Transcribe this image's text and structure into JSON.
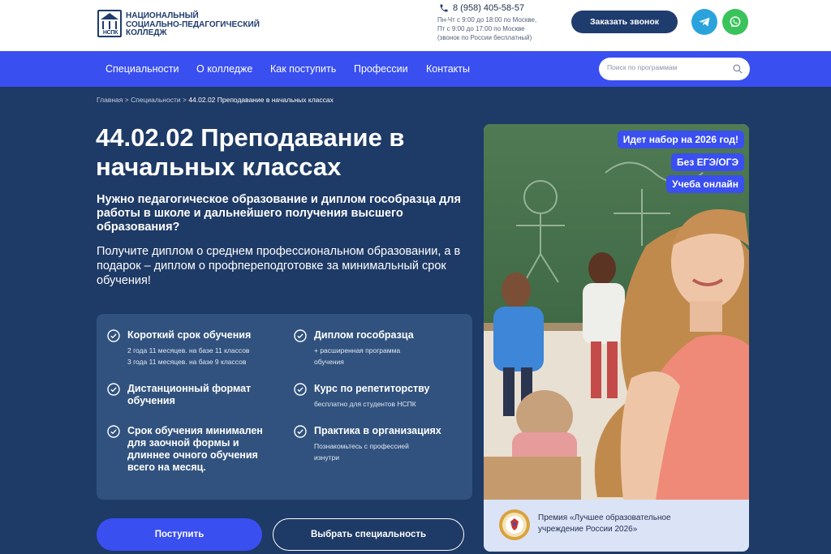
{
  "header": {
    "logo_abbr": "НСПК",
    "logo_text_1": "Национальный",
    "logo_text_2": "социально-педагогический",
    "logo_text_3": "колледж",
    "phone": "8 (958) 405-58-57",
    "hours_1": "Пн-Чт с 9:00 до 18:00 по Москве,",
    "hours_2": "Пт с 9:00 до 17:00 по Москве",
    "hours_3": "(звонок по России бесплатный)",
    "callback_label": "Заказать звонок",
    "icons": {
      "phone": "phone-icon",
      "telegram": "telegram-icon",
      "whatsapp": "whatsapp-icon"
    },
    "colors": {
      "telegram": "#2aa3dc",
      "whatsapp": "#39c35a",
      "brand": "#1f3c6e"
    }
  },
  "nav": {
    "items": [
      {
        "label": "Специальности"
      },
      {
        "label": "О колледже"
      },
      {
        "label": "Как поступить"
      },
      {
        "label": "Профессии"
      },
      {
        "label": "Контакты"
      }
    ],
    "search_placeholder": "Поиск по программам",
    "color": "#3a4ff0"
  },
  "breadcrumb": {
    "home": "Главная",
    "section": "Специальности",
    "separator": ">",
    "current": "44.02.02 Преподавание в начальных классах"
  },
  "main": {
    "title_line1": "44.02.02 Преподавание в",
    "title_line2": "начальных классах",
    "subtitle": "Нужно педагогическое образование и диплом гособразца для работы в школе и дальнейшего получения высшего образования?",
    "lead": "Получите диплом о среднем профессиональном образовании, а в подарок – диплом о профпереподготовке за минимальный срок обучения!",
    "features": [
      {
        "title": "Короткий срок обучения",
        "desc_1": "2 года 11 месяцев. на базе 11 классов",
        "desc_2": "3 года 11 месяцев. на базе 9 классов"
      },
      {
        "title": "Диплом гособразца",
        "desc_1": "+ расширенная программа",
        "desc_2": "обучения"
      },
      {
        "title": "Дистанционный формат обучения",
        "desc_1": "",
        "desc_2": ""
      },
      {
        "title": "Курс по репетиторству",
        "desc_1": "бесплатно для студентов НСПК",
        "desc_2": ""
      },
      {
        "title": "Срок обучения минимален для заочной формы и длиннее очного обучения всего на месяц.",
        "desc_1": "",
        "desc_2": ""
      },
      {
        "title": "Практика в организациях",
        "desc_1": "Познакомьтесь с профессией",
        "desc_2": "изнутри"
      }
    ],
    "apply_label": "Поступить",
    "choose_label": "Выбрать специальность"
  },
  "card": {
    "badges": [
      "Идет набор на 2026 год!",
      "Без ЕГЭ/ОГЭ",
      "Учеба онлайн"
    ],
    "award_line1": "Премия «Лучшее образовательное",
    "award_line2": "учреждение России 2026»"
  }
}
